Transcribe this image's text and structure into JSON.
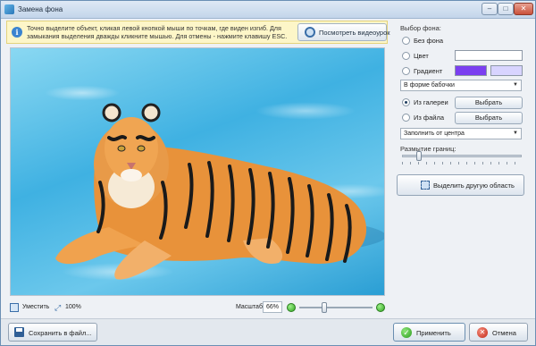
{
  "window": {
    "title": "Замена фона",
    "icon": "app-icon",
    "controls": {
      "minimize": "–",
      "maximize": "□",
      "close": "✕"
    }
  },
  "info": {
    "icon": "info-icon",
    "line1": "Точно выделите объект, кликая левой кнопкой мыши по точкам, где виден изгиб. Для",
    "line2": "замыкания выделения дважды кликните мышью. Для отмены - нажмите клавишу ESC.",
    "video_button": "Посмотреть видеоурок"
  },
  "statusbar": {
    "fit_label": "Уместить",
    "hundred_label": "100%",
    "scale_label": "Масштаб:",
    "scale_value": "66%",
    "zoom_level": 0.33
  },
  "panel": {
    "heading": "Выбор фона:",
    "no_bg": "Без фона",
    "color": "Цвет",
    "color_value": "#ffffff",
    "gradient": "Градиент",
    "gradient_color1": "#7b3ff0",
    "gradient_color2": "#d8d4ff",
    "shape_select": "В форме бабочки",
    "from_gallery": "Из галереи",
    "choose1": "Выбрать",
    "from_file": "Из файла",
    "choose2": "Выбрать",
    "fill_select": "Заполнить от центра",
    "selected_source": "from_gallery",
    "blur_heading": "Размытие границ:",
    "blur_level": 0.12,
    "select_area_button": "Выделить другую область"
  },
  "bottom": {
    "save": "Сохранить в файл...",
    "apply": "Применить",
    "cancel": "Отмена"
  }
}
